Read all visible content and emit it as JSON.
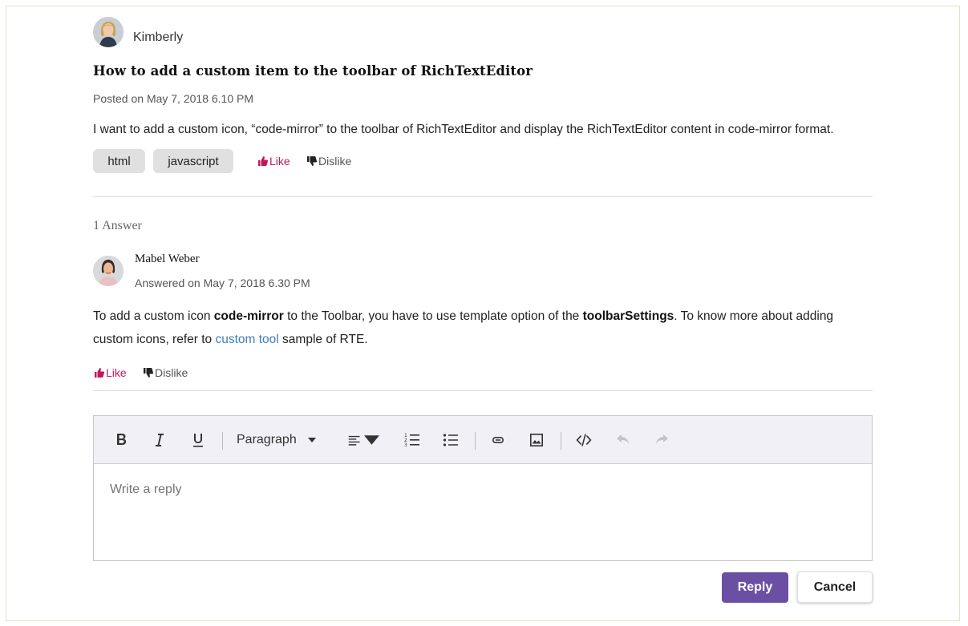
{
  "question": {
    "author": "Kimberly",
    "title": "How to add a custom item to the toolbar of RichTextEditor",
    "posted": "Posted on May 7, 2018 6.10 PM",
    "body": "I want to add a custom icon, “code-mirror” to the toolbar of RichTextEditor and display the RichTextEditor content in code-mirror format.",
    "tags": [
      "html",
      "javascript"
    ],
    "like_label": "Like",
    "dislike_label": "Dislike"
  },
  "answers": {
    "count_label": "1 Answer",
    "items": [
      {
        "author": "Mabel Weber",
        "answered": "Answered on May 7, 2018 6.30 PM",
        "body": {
          "t1": "To add a custom icon ",
          "b1": "code-mirror",
          "t2": " to the Toolbar, you have to use template option of the ",
          "b2": "toolbarSettings",
          "t3": ". To know more about adding custom icons, refer to ",
          "link": "custom tool",
          "t4": " sample of RTE."
        },
        "like_label": "Like",
        "dislike_label": "Dislike"
      }
    ]
  },
  "editor": {
    "format_label": "Paragraph",
    "placeholder": "Write a reply",
    "toolbar_icons": [
      "bold-icon",
      "italic-icon",
      "underline-icon",
      "formats-dropdown",
      "alignment-icon",
      "ordered-list-icon",
      "unordered-list-icon",
      "link-icon",
      "image-icon",
      "source-code-icon",
      "undo-icon",
      "redo-icon"
    ]
  },
  "actions": {
    "reply_label": "Reply",
    "cancel_label": "Cancel"
  },
  "colors": {
    "accent": "#6b4fa4",
    "like": "#c2185b",
    "link": "#3f7fb5",
    "frame_border": "#e2e1c9"
  }
}
